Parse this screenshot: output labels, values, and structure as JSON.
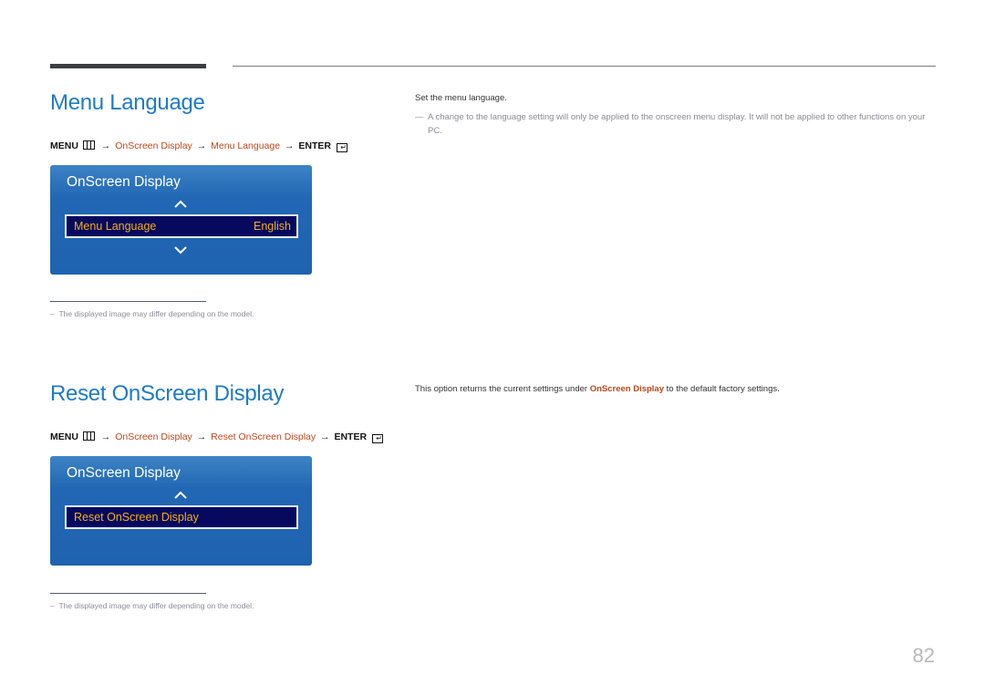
{
  "page_number": "82",
  "sections": [
    {
      "title": "Menu Language",
      "path": {
        "menu": "MENU",
        "arrow": "→",
        "item1": "OnScreen Display",
        "item2": "Menu Language",
        "enter": "ENTER"
      },
      "osd": {
        "title": "OnScreen Display",
        "selected_label": "Menu Language",
        "selected_value": "English",
        "has_up": true,
        "has_down": true
      },
      "note": "The displayed image may differ depending on the model.",
      "description": "Set the menu language.",
      "subnote": "A change to the language setting will only be applied to the onscreen menu display. It will not be applied to other functions on your PC."
    },
    {
      "title": "Reset OnScreen Display",
      "path": {
        "menu": "MENU",
        "arrow": "→",
        "item1": "OnScreen Display",
        "item2": "Reset OnScreen Display",
        "enter": "ENTER"
      },
      "osd": {
        "title": "OnScreen Display",
        "selected_label": "Reset OnScreen Display",
        "has_up": true,
        "has_down": false
      },
      "note": "The displayed image may differ depending on the model.",
      "description_pre": "This option returns the current settings under ",
      "description_hl": "OnScreen Display",
      "description_post": " to the default factory settings."
    }
  ],
  "note_dash": "–",
  "subnote_dash": "—"
}
